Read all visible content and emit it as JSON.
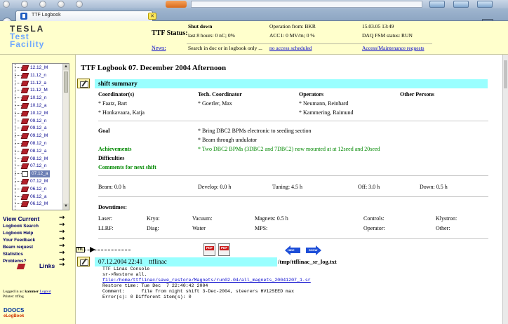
{
  "browser": {
    "tab_title": "TTF Logbook",
    "tab_close": "✕"
  },
  "header": {
    "logo_line1": "TESLA",
    "logo_line2": "Test",
    "logo_line3": "Facility",
    "status_label": "TTF Status:",
    "news_label": "News:",
    "status_row1": {
      "c1": "Shut down",
      "c2": "Operation from: BKR",
      "c3": "15.03.05 13:49"
    },
    "status_row2": {
      "c1": "last 8 hours: 0 nC; 0%",
      "c2": "ACC1: 0 MV/m; 0 %",
      "c3": "DAQ FSM status: RUN"
    },
    "news_row": {
      "c1": "Search in doc or in logbook only ...",
      "c2": "no access scheduled",
      "c3": "Access/Maintenance requests"
    }
  },
  "sidebar": {
    "tree_items": [
      "12.12_M",
      "11.12_n",
      "11.12_a",
      "11.12_M",
      "10.12_n",
      "10.12_a",
      "10.12_M",
      "09.12_n",
      "09.12_a",
      "09.12_M",
      "08.12_n",
      "08.12_a",
      "08.12_M",
      "07.12_n",
      "07.12_a",
      "07.12_M",
      "06.12_n",
      "06.12_a",
      "06.12_M"
    ],
    "selected_item": "07.12_a",
    "links": {
      "view_current": "View Current",
      "logbook_search": "Logbook Search",
      "logbook_help": "Logbook Help",
      "your_feedback": "Your Feedback",
      "beam_request": "Beam request",
      "statistics": "Statistics",
      "problems": "Problems?",
      "links": "Links"
    },
    "logged_in_prefix": "Logged in as:",
    "logged_in_user": "kammer",
    "logout": "Logout",
    "printer": "Printer: ttflog",
    "doocs": "DOOCS",
    "elogbook": "eLogBook"
  },
  "main": {
    "title": "TTF Logbook 07. December 2004 Afternoon",
    "summary_label": "shift summary",
    "roles": {
      "coordinator": "Coordinator(s)",
      "tech_coordinator": "Tech. Coordinator",
      "operators": "Operators",
      "other_persons": "Other Persons"
    },
    "coordinators": [
      "* Faatz, Bart",
      "* Honkavaara, Katja"
    ],
    "tech_coordinators": [
      "* Goerler, Max"
    ],
    "operators": [
      "* Neumann, Reinhard",
      "* Kammering, Raimund"
    ],
    "goal_label": "Goal",
    "goals": [
      "* Bring DBC2 BPMs electronic to seeding section",
      "* Beam through undulator"
    ],
    "achievements_label": "Achievements",
    "achievement": "* Two DBC2 BPMs (3DBC2 and 7DBC2) now mounted at at 12seed and 20seed",
    "difficulties_label": "Difficulties",
    "comments_label": "Comments for next shift",
    "times": {
      "beam": "Beam: 0.0 h",
      "develop": "Develop: 0.0 h",
      "tuning": "Tuning: 4.5 h",
      "off": "Off: 3.0 h",
      "down": "Down: 0.5 h"
    },
    "downtimes_label": "Downtimes:",
    "downtimes_row1": {
      "laser": "Laser:",
      "kryo": "Kryo:",
      "vacuum": "Vacuum:",
      "magnets": "Magnets: 0.5 h",
      "controls": "Controls:",
      "klystron": "Klystron:"
    },
    "downtimes_row2": {
      "llrf": "LLRF:",
      "diag": "Diag:",
      "water": "Water",
      "mps": "MPS:",
      "operator": "Operator:",
      "other": "Other:"
    },
    "entry_tag": "TTL",
    "pdf_label": "PDF",
    "nav_prev": "HIDE",
    "nav_next": "SHOW",
    "entry_date": "07.12.2004 22:41",
    "entry_author": "ttflinac",
    "entry_file": "/tmp/ttflinac_sr_log.txt",
    "console": {
      "l1": "TTF Linac Console",
      "l2": "sr->Restore all.",
      "l3": "file:/home/ttflinac/save_restore/Magnets/run02-04/all_magnets_20041207_1.sr",
      "l4": "Restore time: Tue Dec  7 22:40:42 2004",
      "l5": "Comment:      file from night shift 3-Dec-2004, steerers HV12SEED max",
      "l6": "Error(s): 0 Different item(s): 0"
    }
  }
}
